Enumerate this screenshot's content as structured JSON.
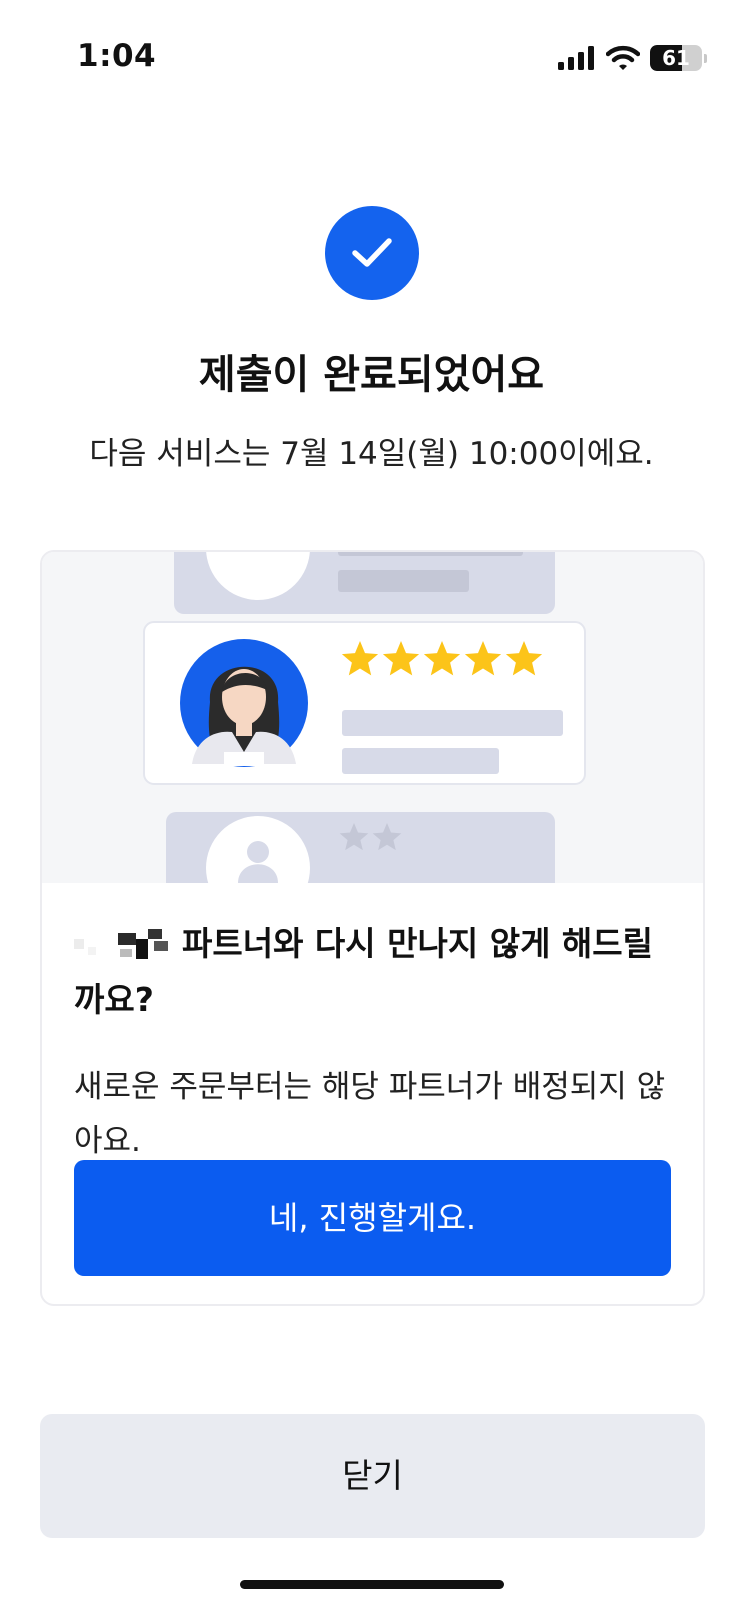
{
  "status_bar": {
    "time": "1:04",
    "battery_level": "61",
    "icons": [
      "signal-icon",
      "wifi-icon",
      "battery-icon"
    ]
  },
  "success": {
    "icon": "check-icon",
    "title": "제출이 완료되었어요",
    "subtitle": "다음 서비스는 7월 14일(월) 10:00이에요."
  },
  "partner_card": {
    "illustration": {
      "rating_stars": 5,
      "other_review_stars": 2
    },
    "headline": "파트너와 다시 만나지 않게 해드릴까요?",
    "body": "새로운 주문부터는 해당 파트너가 배정되지 않아요.",
    "confirm_label": "네, 진행할게요."
  },
  "footer": {
    "close_label": "닫기"
  },
  "colors": {
    "accent": "#0b5cf0",
    "star": "#fcc419",
    "close_bg": "#e9ebf1"
  }
}
